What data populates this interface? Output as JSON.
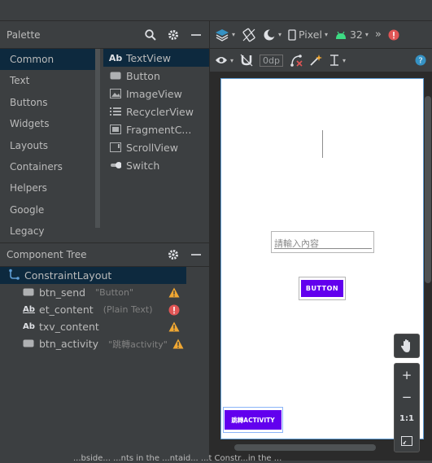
{
  "palette": {
    "title": "Palette",
    "categories": [
      "Common",
      "Text",
      "Buttons",
      "Widgets",
      "Layouts",
      "Containers",
      "Helpers",
      "Google",
      "Legacy"
    ],
    "items": [
      {
        "icon": "Ab",
        "label": "TextView"
      },
      {
        "icon": "button-icon",
        "label": "Button"
      },
      {
        "icon": "image-icon",
        "label": "ImageView"
      },
      {
        "icon": "list-icon",
        "label": "RecyclerView"
      },
      {
        "icon": "fragment-icon",
        "label": "FragmentC..."
      },
      {
        "icon": "scroll-icon",
        "label": "ScrollView"
      },
      {
        "icon": "switch-icon",
        "label": "Switch"
      }
    ]
  },
  "tree": {
    "title": "Component Tree",
    "root": "ConstraintLayout",
    "nodes": [
      {
        "icon": "button-icon",
        "name": "btn_send",
        "detail": "\"Button\"",
        "status": "warning"
      },
      {
        "icon": "Ab",
        "name": "et_content",
        "detail": "(Plain Text)",
        "status": "error"
      },
      {
        "icon": "Ab",
        "name": "txv_content",
        "detail": "",
        "status": "warning"
      },
      {
        "icon": "button-icon",
        "name": "btn_activity",
        "detail": "\"跳轉activity\"",
        "status": "warning"
      }
    ]
  },
  "toolbar": {
    "device": "Pixel",
    "api": "32",
    "margin": "0dp"
  },
  "preview": {
    "edittext_hint": "請輸入內容",
    "button_label": "BUTTON",
    "button2_label": "跳轉ACTIVITY"
  },
  "zoom": {
    "plus": "+",
    "minus": "−",
    "one_to_one": "1:1"
  },
  "status_bar": {
    "text": "...bside... ...nts in the ...ntaid... ...t Constr...in the ..."
  },
  "colors": {
    "accent": "#6200ee",
    "selection": "#0d293e",
    "warning": "#f0a732",
    "error": "#e05555",
    "android_green": "#3ddc84"
  }
}
